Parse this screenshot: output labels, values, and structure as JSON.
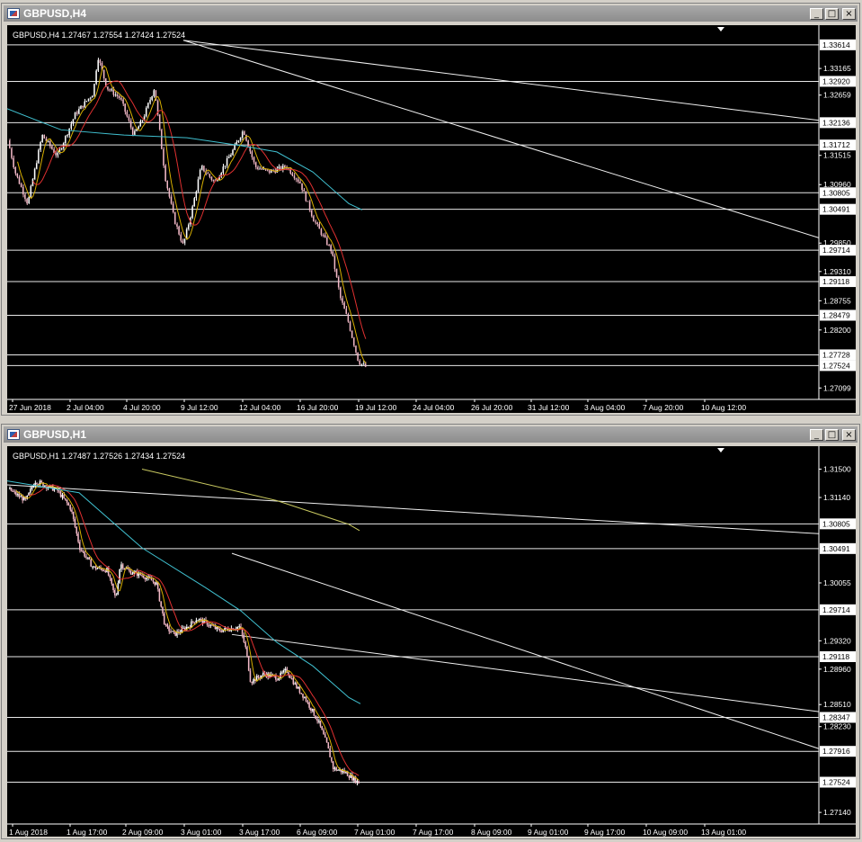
{
  "windows": [
    {
      "id": "h4",
      "title": "GBPUSD,H4",
      "info": "GBPUSD,H4  1.27467 1.27554 1.27424 1.27524",
      "price_labels": [
        "1.33614",
        "1.33165",
        "1.32920",
        "1.32659",
        "1.32136",
        "1.31712",
        "1.31515",
        "1.30960",
        "1.30805",
        "1.30491",
        "1.29850",
        "1.29714",
        "1.29310",
        "1.29118",
        "1.28755",
        "1.28479",
        "1.28200",
        "1.27728",
        "1.27524",
        "1.27099"
      ],
      "time_labels": [
        "27 Jun 2018",
        "2 Jul 04:00",
        "4 Jul 20:00",
        "9 Jul 12:00",
        "12 Jul 04:00",
        "16 Jul 20:00",
        "19 Jul 12:00",
        "24 Jul 04:00",
        "26 Jul 20:00",
        "31 Jul 12:00",
        "3 Aug 04:00",
        "7 Aug 20:00",
        "10 Aug 12:00"
      ]
    },
    {
      "id": "h1",
      "title": "GBPUSD,H1",
      "info": "GBPUSD,H1  1.27487 1.27526 1.27434 1.27524",
      "price_labels": [
        "1.31500",
        "1.31140",
        "1.30805",
        "1.30491",
        "1.30055",
        "1.29714",
        "1.29320",
        "1.29118",
        "1.28960",
        "1.28510",
        "1.28347",
        "1.28230",
        "1.27916",
        "1.27524",
        "1.27140"
      ],
      "time_labels": [
        "1 Aug 2018",
        "1 Aug 17:00",
        "2 Aug 09:00",
        "3 Aug 01:00",
        "3 Aug 17:00",
        "6 Aug 09:00",
        "7 Aug 01:00",
        "7 Aug 17:00",
        "8 Aug 09:00",
        "9 Aug 01:00",
        "9 Aug 17:00",
        "10 Aug 09:00",
        "13 Aug 01:00"
      ]
    }
  ],
  "controls": {
    "minimize": "_",
    "maximize": "□",
    "close": "×"
  },
  "colors": {
    "background": "#000000",
    "bull": "#ffffff",
    "bear": "#f2b8c6",
    "ma_fast": "#d8b000",
    "ma_mid": "#e03030",
    "ma_slow": "#40c0d0",
    "ma_long": "#c8c860"
  }
}
